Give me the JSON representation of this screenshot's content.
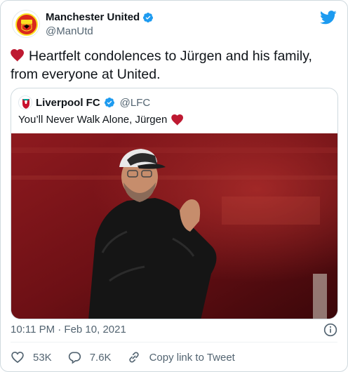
{
  "author": {
    "name": "Manchester United",
    "handle": "@ManUtd"
  },
  "tweet": {
    "text": "Heartfelt condolences to Jürgen and his family, from everyone at United."
  },
  "quoted": {
    "name": "Liverpool FC",
    "handle": "@LFC",
    "text": "You’ll Never Walk Alone, Jürgen"
  },
  "meta": {
    "timestamp": "10:11 PM · Feb 10, 2021"
  },
  "actions": {
    "likes": "53K",
    "replies": "7.6K",
    "copy_link": "Copy link to Tweet"
  },
  "colors": {
    "twitter_blue": "#1d9bf0",
    "heart_red": "#be1931",
    "text_primary": "#0f1419",
    "text_secondary": "#536471"
  }
}
